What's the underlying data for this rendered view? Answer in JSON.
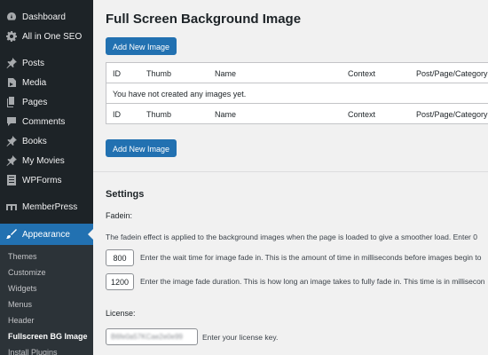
{
  "sidebar": {
    "items": [
      {
        "label": "Dashboard",
        "icon": "dashboard-icon"
      },
      {
        "label": "All in One SEO",
        "icon": "gear-icon"
      },
      {
        "label": "Posts",
        "icon": "pin-icon"
      },
      {
        "label": "Media",
        "icon": "media-icon"
      },
      {
        "label": "Pages",
        "icon": "pages-icon"
      },
      {
        "label": "Comments",
        "icon": "comment-icon"
      },
      {
        "label": "Books",
        "icon": "pin-icon"
      },
      {
        "label": "My Movies",
        "icon": "pin-icon"
      },
      {
        "label": "WPForms",
        "icon": "forms-icon"
      },
      {
        "label": "MemberPress",
        "icon": "memberpress-icon"
      },
      {
        "label": "Appearance",
        "icon": "brush-icon"
      }
    ],
    "submenu": [
      "Themes",
      "Customize",
      "Widgets",
      "Menus",
      "Header",
      "Fullscreen BG Image",
      "Install Plugins"
    ],
    "active_color": "#2271b1"
  },
  "main": {
    "title": "Full Screen Background Image",
    "add_button": "Add New Image",
    "table": {
      "columns": [
        "ID",
        "Thumb",
        "Name",
        "Context",
        "Post/Page/Category"
      ],
      "empty_message": "You have not created any images yet."
    },
    "settings": {
      "title": "Settings",
      "fadein_label": "Fadein:",
      "fadein_description": "The fadein effect is applied to the background images when the page is loaded to give a smoother load. Enter 0",
      "wait_value": "800",
      "wait_help": "Enter the wait time for image fade in. This is the amount of time in milliseconds before images begin to",
      "duration_value": "1200",
      "duration_help": "Enter the image fade duration. This is how long an image takes to fully fade in. This time is in millisecon",
      "license_label": "License:",
      "license_value": "B6fe0a57KCae2e0e99",
      "license_help": "Enter your license key."
    }
  }
}
